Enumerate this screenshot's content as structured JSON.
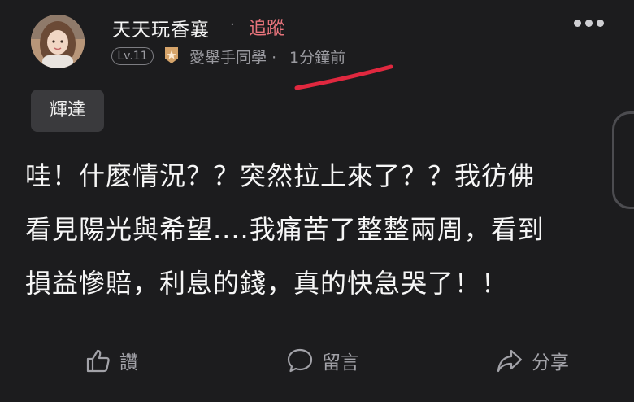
{
  "author": {
    "name": "天天玩香襄",
    "separator": "·",
    "follow_label": "追蹤",
    "level": "Lv.11",
    "group": "愛舉手同學",
    "time_separator": "·",
    "time": "1分鐘前"
  },
  "tag": {
    "label": "輝達"
  },
  "post": {
    "lines": [
      "哇！什麼情況？？突然拉上來了？？我彷佛",
      "看見陽光與希望....我痛苦了整整兩周，看到",
      "損益慘賠，利息的錢，真的快急哭了！！"
    ]
  },
  "actions": {
    "like_label": "讚",
    "comment_label": "留言",
    "share_label": "分享"
  },
  "icons": {
    "more": "more-dots-icon",
    "badge": "badge-icon",
    "like": "thumbs-up-icon",
    "comment": "comment-bubble-icon",
    "share": "share-arrow-icon"
  },
  "colors": {
    "background": "#1c1c1e",
    "follow": "#e8747c",
    "annotation": "#e0283f",
    "muted": "#9a9aa0"
  }
}
